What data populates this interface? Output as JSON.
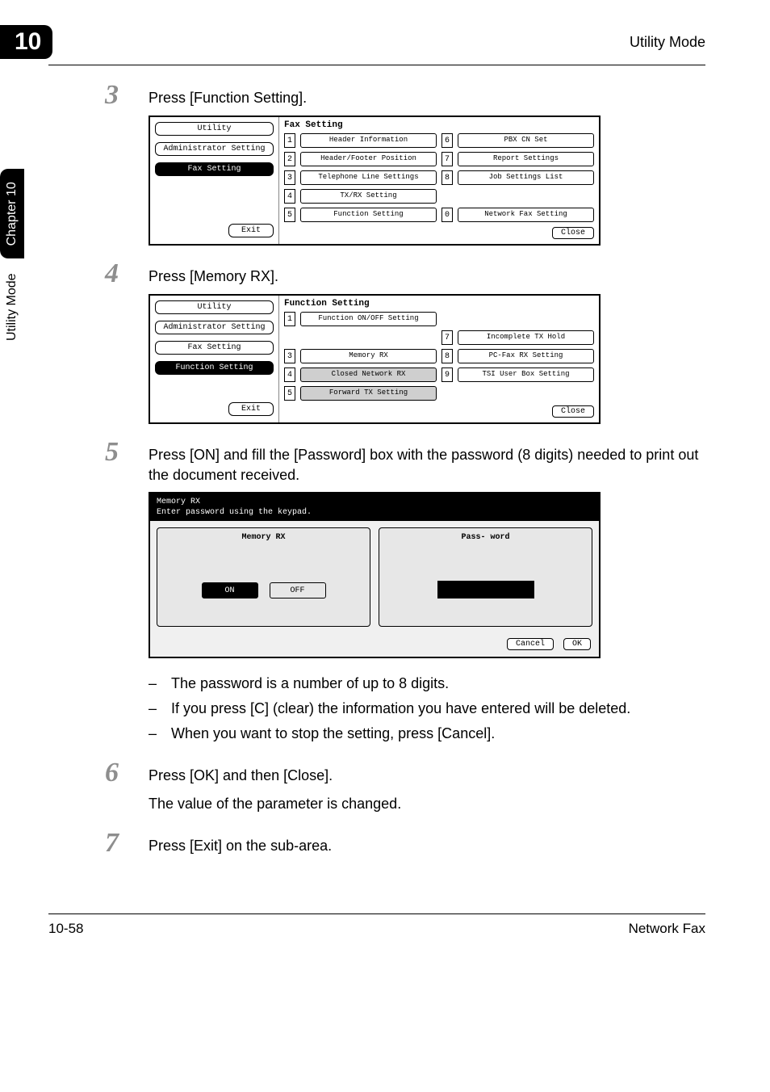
{
  "header": {
    "chapter_num": "10",
    "right_text": "Utility Mode"
  },
  "side_tab": {
    "chapter": "Chapter 10",
    "title": "Utility Mode"
  },
  "steps": {
    "s3": {
      "num": "3",
      "text": "Press [Function Setting]."
    },
    "s4": {
      "num": "4",
      "text": "Press [Memory RX]."
    },
    "s5": {
      "num": "5",
      "text": "Press [ON] and fill the [Password] box with the password (8 digits) needed to print out the document received."
    },
    "s6": {
      "num": "6",
      "text": "Press [OK] and then [Close].",
      "sub": "The value of the parameter is changed."
    },
    "s7": {
      "num": "7",
      "text": "Press [Exit] on the sub-area."
    }
  },
  "bullets": {
    "b1": "The password is a number of up to 8 digits.",
    "b2": "If you press [C] (clear) the information you have entered will be deleted.",
    "b3": "When you want to stop the setting, press [Cancel]."
  },
  "panel1": {
    "side": {
      "utility": "Utility",
      "admin": "Administrator Setting",
      "fax": "Fax Setting",
      "exit": "Exit"
    },
    "title": "Fax Setting",
    "items": {
      "n1": "1",
      "t1": "Header Information",
      "n2": "2",
      "t2": "Header/Footer Position",
      "n3": "3",
      "t3": "Telephone Line Settings",
      "n4": "4",
      "t4": "TX/RX Setting",
      "n5": "5",
      "t5": "Function Setting",
      "n6": "6",
      "t6": "PBX CN Set",
      "n7": "7",
      "t7": "Report Settings",
      "n8": "8",
      "t8": "Job Settings List",
      "n0": "0",
      "t0": "Network Fax Setting"
    },
    "close": "Close"
  },
  "panel2": {
    "side": {
      "utility": "Utility",
      "admin": "Administrator Setting",
      "fax": "Fax Setting",
      "func": "Function Setting",
      "exit": "Exit"
    },
    "title": "Function Setting",
    "items": {
      "n1": "1",
      "t1": "Function ON/OFF Setting",
      "n3": "3",
      "t3": "Memory RX",
      "n4": "4",
      "t4": "Closed Network RX",
      "n5": "5",
      "t5": "Forward TX Setting",
      "n7": "7",
      "t7": "Incomplete TX Hold",
      "n8": "8",
      "t8": "PC-Fax RX Setting",
      "n9": "9",
      "t9": "TSI User Box Setting"
    },
    "close": "Close"
  },
  "panel3": {
    "dark1": "Memory RX",
    "dark2": "Enter password using the keypad.",
    "left_label": "Memory RX",
    "on": "ON",
    "off": "OFF",
    "right_label": "Pass- word",
    "cancel": "Cancel",
    "ok": "OK"
  },
  "footer": {
    "left": "10-58",
    "right": "Network Fax"
  }
}
